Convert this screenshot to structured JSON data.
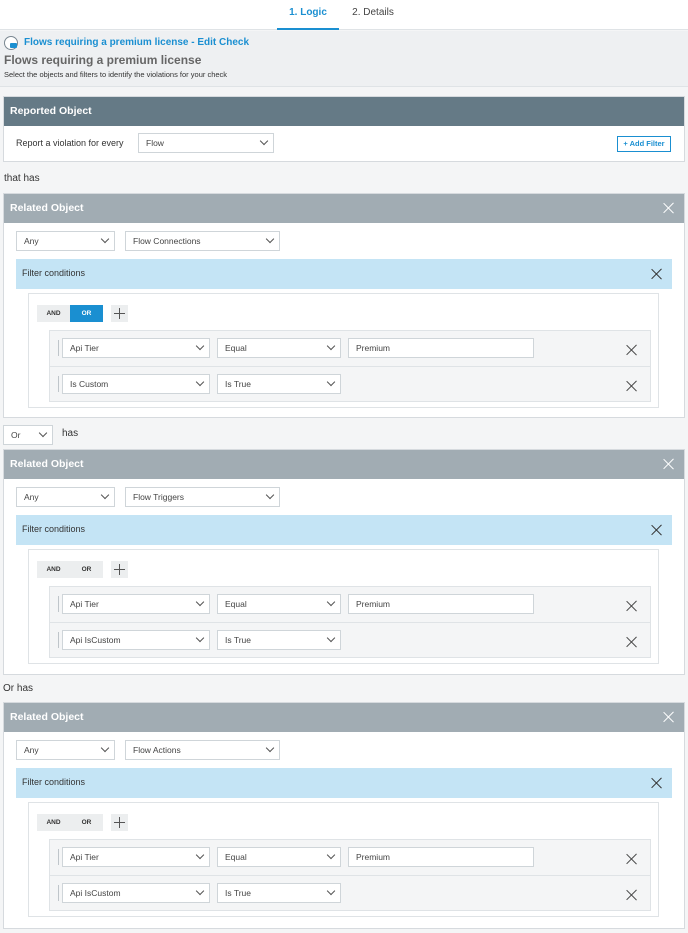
{
  "tabs": [
    {
      "label": "1. Logic",
      "active": true
    },
    {
      "label": "2. Details",
      "active": false
    }
  ],
  "header": {
    "breadcrumb": "Flows requiring a premium license - Edit Check",
    "title": "Flows requiring a premium license",
    "subtitle": "Select the objects and filters to identify the violations for your check"
  },
  "reported": {
    "title": "Reported Object",
    "label": "Report a violation for every",
    "object": "Flow",
    "add_filter": "+ Add Filter"
  },
  "connectors": {
    "first": "that has",
    "second_select": "Or",
    "second_text": "has",
    "third": "Or has"
  },
  "related": [
    {
      "title": "Related Object",
      "quantifier": "Any",
      "object": "Flow Connections",
      "filter_title": "Filter conditions",
      "and_label": "AND",
      "or_label": "OR",
      "active": "OR",
      "rows": [
        {
          "field": "Api Tier",
          "operator": "Equal",
          "value": "Premium"
        },
        {
          "field": "Is Custom",
          "operator": "Is True",
          "value": ""
        }
      ]
    },
    {
      "title": "Related Object",
      "quantifier": "Any",
      "object": "Flow Triggers",
      "filter_title": "Filter conditions",
      "and_label": "AND",
      "or_label": "OR",
      "active": "",
      "rows": [
        {
          "field": "Api Tier",
          "operator": "Equal",
          "value": "Premium"
        },
        {
          "field": "Api IsCustom",
          "operator": "Is True",
          "value": ""
        }
      ]
    },
    {
      "title": "Related Object",
      "quantifier": "Any",
      "object": "Flow Actions",
      "filter_title": "Filter conditions",
      "and_label": "AND",
      "or_label": "OR",
      "active": "",
      "rows": [
        {
          "field": "Api Tier",
          "operator": "Equal",
          "value": "Premium"
        },
        {
          "field": "Api IsCustom",
          "operator": "Is True",
          "value": ""
        }
      ]
    }
  ],
  "colors": {
    "accent": "#1a8fd1",
    "reported_bar": "#657a86",
    "related_bar": "#a1acb3",
    "filter_bar": "#c4e4f5"
  }
}
